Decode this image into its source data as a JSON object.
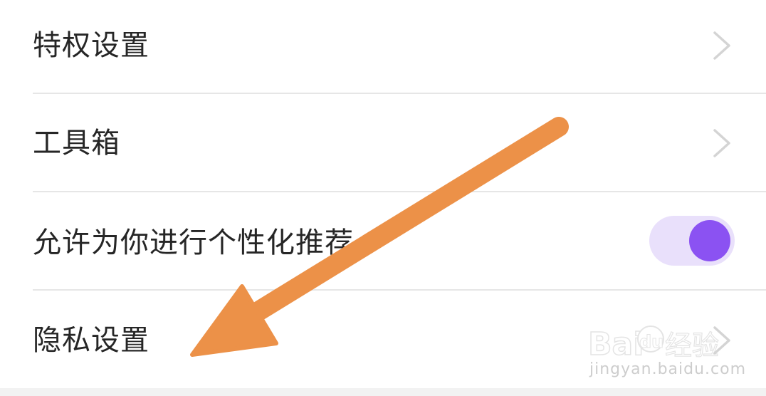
{
  "settings": {
    "items": [
      {
        "label": "特权设置",
        "control": "chevron"
      },
      {
        "label": "工具箱",
        "control": "chevron"
      },
      {
        "label": "允许为你进行个性化推荐",
        "control": "toggle",
        "toggle_on": true
      },
      {
        "label": "隐私设置",
        "control": "chevron"
      }
    ]
  },
  "colors": {
    "toggle_track": "#e9e0fb",
    "toggle_knob": "#8b52f2",
    "annotation_arrow": "#ec9148"
  },
  "icons": {
    "chevron": "chevron-right-icon",
    "arrow": "annotation-arrow-icon"
  },
  "watermark": {
    "logo": "Baidu经验",
    "url": "jingyan.baidu.com"
  }
}
